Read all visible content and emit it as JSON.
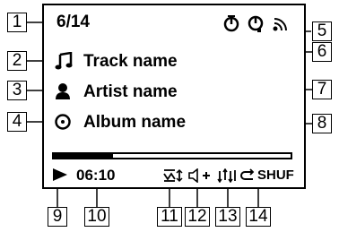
{
  "track_position": "6/14",
  "track_name": "Track name",
  "artist_name": "Artist name",
  "album_name": "Album name",
  "elapsed_time": "06:10",
  "progress": 0.25,
  "shuffle_label": "SHUF",
  "callouts": [
    "1",
    "2",
    "3",
    "4",
    "5",
    "6",
    "7",
    "8",
    "9",
    "10",
    "11",
    "12",
    "13",
    "14"
  ]
}
